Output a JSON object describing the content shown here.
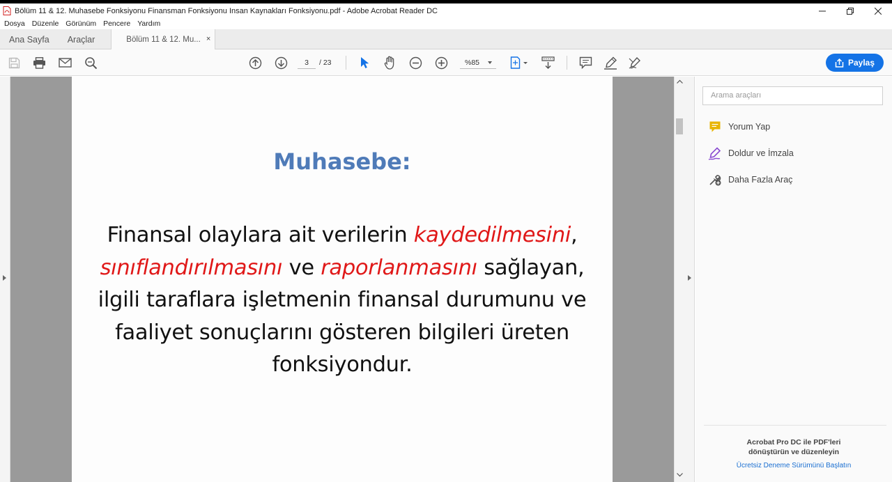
{
  "window": {
    "title": "Bölüm 11 & 12. Muhasebe Fonksiyonu Finansman Fonksiyonu Insan Kaynakları Fonksiyonu.pdf - Adobe Acrobat Reader DC"
  },
  "menu": [
    "Dosya",
    "Düzenle",
    "Görünüm",
    "Pencere",
    "Yardım"
  ],
  "tabs": {
    "home": "Ana Sayfa",
    "tools": "Araçlar",
    "document": "Bölüm 11 & 12. Mu...",
    "close": "×"
  },
  "toolbar": {
    "current_page": "3",
    "page_total": "/  23",
    "zoom": "%85",
    "share_label": "Paylaş"
  },
  "document": {
    "heading": "Muhasebe:",
    "p1": "Finansal olaylara ait verilerin ",
    "e1": "kaydedilmesini",
    "p2": ", ",
    "e2": "sınıflandırılmasını",
    "p3": " ve ",
    "e3": "raporlanmasını",
    "p4": " sağlayan, ilgili taraflara işletmenin finansal durumunu ve faaliyet sonuçlarını gösteren bilgileri üreten fonksiyondur."
  },
  "right_panel": {
    "search_placeholder": "Arama araçları",
    "tools": [
      {
        "label": "Yorum Yap",
        "icon": "comment-icon"
      },
      {
        "label": "Doldur ve İmzala",
        "icon": "fill-sign-icon"
      },
      {
        "label": "Daha Fazla Araç",
        "icon": "more-tools-icon"
      }
    ],
    "promo_line1": "Acrobat Pro DC ile PDF'leri",
    "promo_line2": "dönüştürün ve düzenleyin",
    "promo_link": "Ücretsiz Deneme Sürümünü Başlatın"
  },
  "colors": {
    "heading": "#4f7bb8",
    "emphasis": "#e01818",
    "share_button": "#1473e6",
    "comment_icon": "#e8b400",
    "fill_sign_icon": "#8a4bd1"
  }
}
